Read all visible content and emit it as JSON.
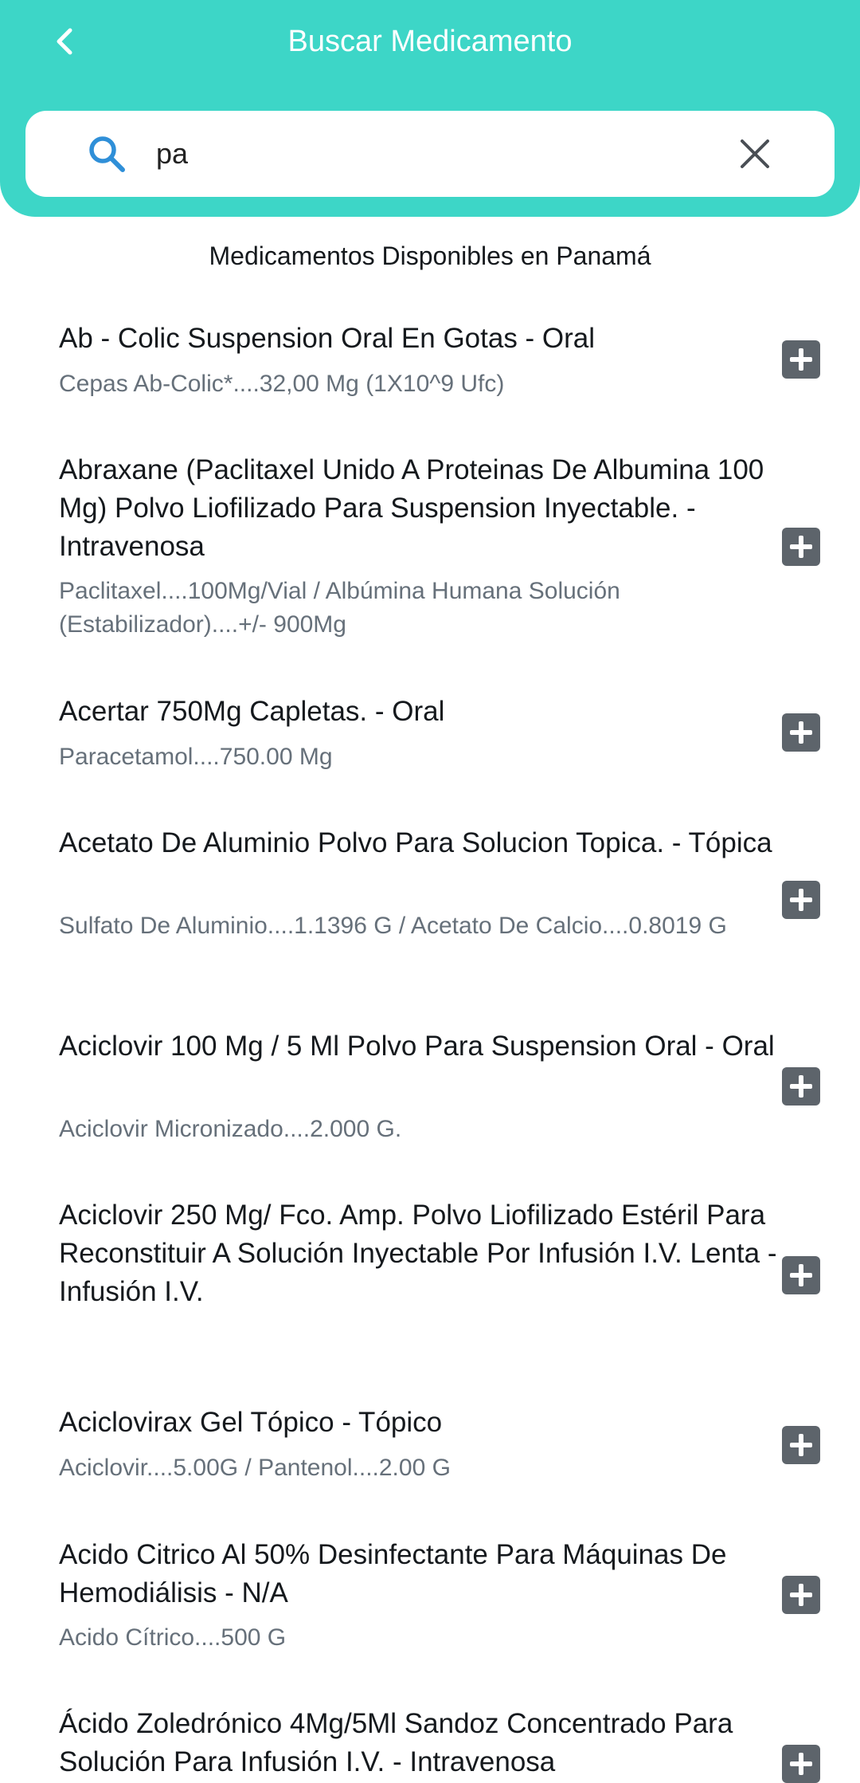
{
  "header": {
    "title": "Buscar Medicamento",
    "back_icon": "chevron-left-icon",
    "background_color": "#3dd6c7"
  },
  "search": {
    "value": "pa",
    "search_icon": "search-icon",
    "clear_icon": "close-icon"
  },
  "section_title": "Medicamentos Disponibles en Panamá",
  "medications": [
    {
      "name": "Ab - Colic Suspension Oral En Gotas - Oral",
      "desc": "Cepas Ab-Colic*....32,00 Mg (1X10^9 Ufc)"
    },
    {
      "name": "Abraxane (Paclitaxel Unido A Proteinas De Albumina 100 Mg) Polvo Liofilizado Para Suspension Inyectable. - Intravenosa",
      "desc": "Paclitaxel....100Mg/Vial / Albúmina Humana Solución (Estabilizador)....+/- 900Mg"
    },
    {
      "name": "Acertar 750Mg Capletas. - Oral",
      "desc": "Paracetamol....750.00 Mg"
    },
    {
      "name": "Acetato De Aluminio Polvo Para Solucion Topica. - Tópica",
      "desc": "Sulfato De Aluminio....1.1396 G / Acetato De Calcio....0.8019 G"
    },
    {
      "name": "Aciclovir 100 Mg / 5 Ml Polvo Para Suspension Oral - Oral",
      "desc": "Aciclovir Micronizado....2.000 G."
    },
    {
      "name": "Aciclovir 250 Mg/ Fco. Amp. Polvo Liofilizado Estéril Para Reconstituir A Solución Inyectable Por Infusión I.V. Lenta - Infusión I.V.",
      "desc": ""
    },
    {
      "name": "Aciclovirax Gel Tópico - Tópico",
      "desc": "Aciclovir....5.00G / Pantenol....2.00 G"
    },
    {
      "name": "Acido Citrico Al 50% Desinfectante Para Máquinas De Hemodiálisis - N/A",
      "desc": "Acido Cítrico....500 G"
    },
    {
      "name": "Ácido Zoledrónico 4Mg/5Ml Sandoz Concentrado Para Solución Para Infusión I.V. - Intravenosa",
      "desc": ""
    }
  ],
  "add_icon": "plus-square-icon"
}
